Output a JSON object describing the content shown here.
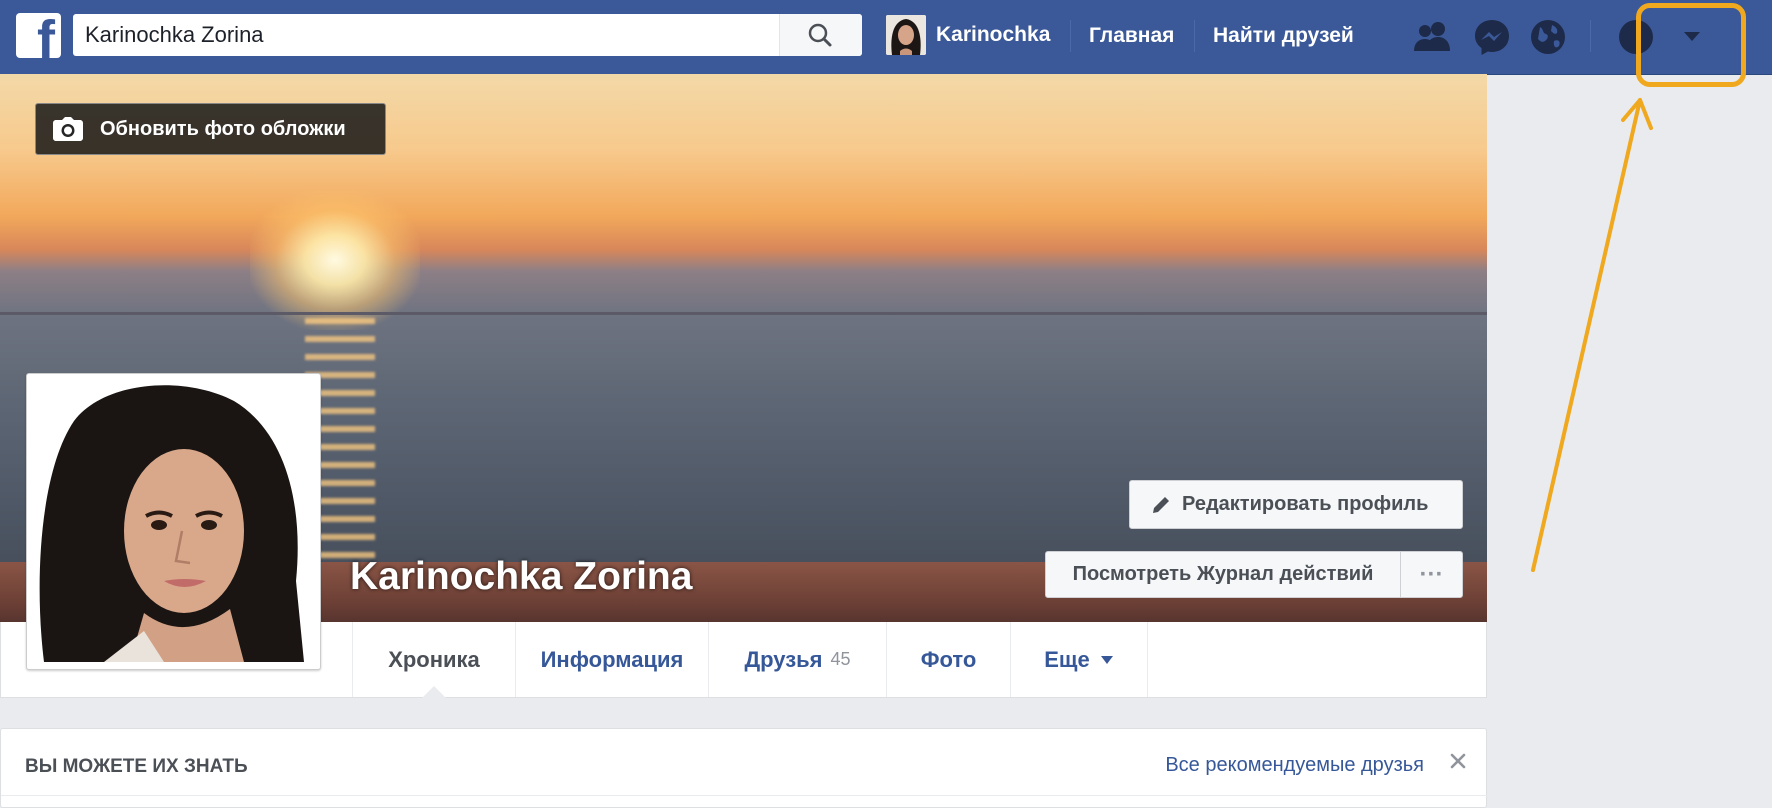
{
  "topbar": {
    "search_value": "Karinochka Zorina",
    "user_name": "Karinochka",
    "home_label": "Главная",
    "find_friends_label": "Найти друзей",
    "logo_letter": "f",
    "icons": [
      "friend-requests-icon",
      "messenger-icon",
      "notifications-globe-icon",
      "help-icon",
      "account-menu-chevron-icon"
    ]
  },
  "cover": {
    "update_cover_label": "Обновить фото обложки",
    "profile_name": "Karinochka Zorina",
    "edit_profile_label": "Редактировать профиль",
    "activity_log_label": "Посмотреть Журнал действий",
    "more_dots": "···"
  },
  "tabs": [
    {
      "label": "Хроника",
      "active": true
    },
    {
      "label": "Информация"
    },
    {
      "label": "Друзья",
      "count": "45"
    },
    {
      "label": "Фото"
    },
    {
      "label": "Еще"
    }
  ],
  "pymk": {
    "title": "ВЫ МОЖЕТЕ ИХ ЗНАТЬ",
    "see_all_label": "Все рекомендуемые друзья",
    "close_glyph": "✕"
  },
  "colors": {
    "brand_blue": "#3b5998",
    "link_blue": "#365899",
    "highlight": "#f0a81e"
  }
}
